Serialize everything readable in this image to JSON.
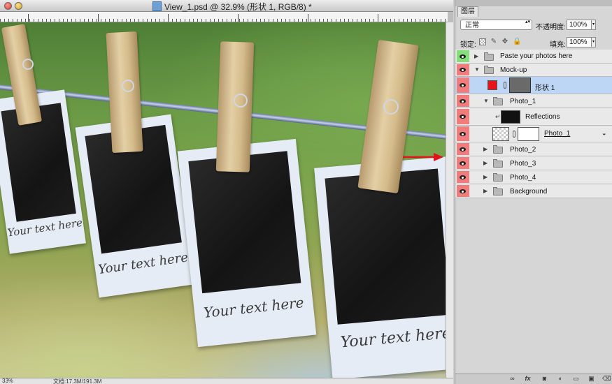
{
  "window": {
    "title": "View_1.psd @ 32.9% (形状 1, RGB/8) *"
  },
  "canvas": {
    "caption_text": "Your text here"
  },
  "status_bar": {
    "zoom": "33%",
    "doc_info": "文档:17.3M/191.3M"
  },
  "layers_panel": {
    "tab_label": "图层",
    "blend_mode": "正常",
    "opacity_label": "不透明度:",
    "opacity_value": "100%",
    "lock_label": "锁定:",
    "fill_label": "填充:",
    "fill_value": "100%",
    "layers": [
      {
        "name": "Paste your photos here",
        "type": "group",
        "expanded": false,
        "visible": true,
        "eye_color": "#86e07a"
      },
      {
        "name": "Mock-up",
        "type": "group",
        "expanded": true,
        "visible": true
      },
      {
        "name": "形状 1",
        "type": "shape",
        "selected": true,
        "visible": true,
        "swatch_color": "#e8141c"
      },
      {
        "name": "Photo_1",
        "type": "group",
        "expanded": true,
        "visible": true
      },
      {
        "name": "Reflections",
        "type": "layer",
        "clipped": true,
        "visible": true
      },
      {
        "name": "Photo_1",
        "type": "smart-object",
        "visible": true
      },
      {
        "name": "Photo_2",
        "type": "group",
        "expanded": false,
        "visible": true
      },
      {
        "name": "Photo_3",
        "type": "group",
        "expanded": false,
        "visible": true
      },
      {
        "name": "Photo_4",
        "type": "group",
        "expanded": false,
        "visible": true
      },
      {
        "name": "Background",
        "type": "group",
        "expanded": false,
        "visible": true
      }
    ],
    "bottom_icons": [
      "link-icon",
      "fx-icon",
      "mask-icon",
      "adjustment-icon",
      "group-icon",
      "new-layer-icon",
      "trash-icon"
    ]
  },
  "colors": {
    "eye_visible": "#f07c7c",
    "selection": "#bdd6f5",
    "annotation_arrow": "#e0141c"
  }
}
